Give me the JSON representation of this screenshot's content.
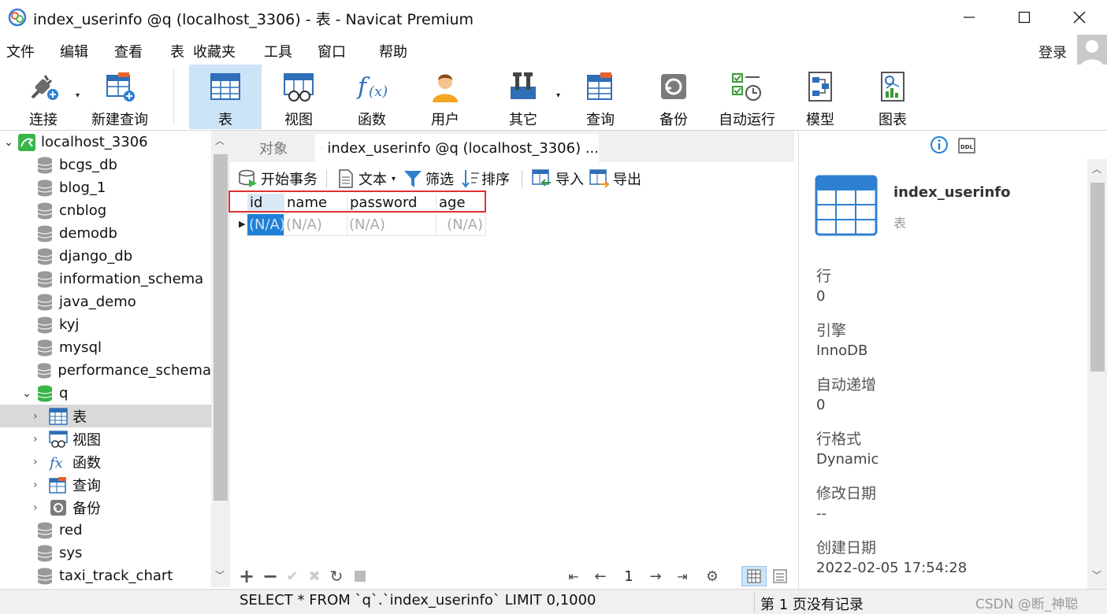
{
  "window": {
    "title": "index_userinfo @q (localhost_3306) - 表 - Navicat Premium"
  },
  "menu": {
    "items": [
      "文件",
      "编辑",
      "查看",
      "表",
      "收藏夹",
      "工具",
      "窗口",
      "帮助"
    ],
    "login": "登录"
  },
  "toolbar": {
    "items": [
      {
        "label": "连接",
        "icon": "connection-plug-icon"
      },
      {
        "label": "新建查询",
        "icon": "new-query-icon"
      },
      {
        "label": "表",
        "icon": "table-icon",
        "active": true
      },
      {
        "label": "视图",
        "icon": "view-icon"
      },
      {
        "label": "函数",
        "icon": "function-icon"
      },
      {
        "label": "用户",
        "icon": "user-icon"
      },
      {
        "label": "其它",
        "icon": "tools-icon"
      },
      {
        "label": "查询",
        "icon": "query-icon"
      },
      {
        "label": "备份",
        "icon": "backup-icon"
      },
      {
        "label": "自动运行",
        "icon": "autorun-icon"
      },
      {
        "label": "模型",
        "icon": "model-icon"
      },
      {
        "label": "图表",
        "icon": "chart-icon"
      }
    ]
  },
  "tree": {
    "connection": "localhost_3306",
    "databases": [
      "bcgs_db",
      "blog_1",
      "cnblog",
      "demodb",
      "django_db",
      "information_schema",
      "java_demo",
      "kyj",
      "mysql",
      "performance_schema"
    ],
    "open_db": "q",
    "open_db_children": [
      {
        "label": "表",
        "icon": "table-icon",
        "selected": true
      },
      {
        "label": "视图",
        "icon": "view-icon"
      },
      {
        "label": "函数",
        "icon": "function-icon"
      },
      {
        "label": "查询",
        "icon": "query-icon"
      },
      {
        "label": "备份",
        "icon": "backup-icon"
      }
    ],
    "more_databases": [
      "red",
      "sys",
      "taxi_track_chart"
    ]
  },
  "tabs": {
    "objects": "对象",
    "table_tab": "index_userinfo @q (localhost_3306) ..."
  },
  "data_toolbar": {
    "begin_tx": "开始事务",
    "text": "文本",
    "filter": "筛选",
    "sort": "排序",
    "import": "导入",
    "export": "导出"
  },
  "grid": {
    "columns": [
      "id",
      "name",
      "password",
      "age"
    ],
    "row": [
      "(N/A)",
      "(N/A)",
      "(N/A)",
      "(N/A)"
    ]
  },
  "pager": {
    "page": "1"
  },
  "status": {
    "sql": "SELECT * FROM `q`.`index_userinfo` LIMIT 0,1000",
    "records": "第 1 页没有记录",
    "watermark": "CSDN @断_神聪"
  },
  "info": {
    "name": "index_userinfo",
    "type": "表",
    "fields": [
      {
        "label": "行",
        "value": "0"
      },
      {
        "label": "引擎",
        "value": "InnoDB"
      },
      {
        "label": "自动递增",
        "value": "0"
      },
      {
        "label": "行格式",
        "value": "Dynamic"
      },
      {
        "label": "修改日期",
        "value": "--"
      },
      {
        "label": "创建日期",
        "value": "2022-02-05 17:54:28"
      }
    ]
  }
}
